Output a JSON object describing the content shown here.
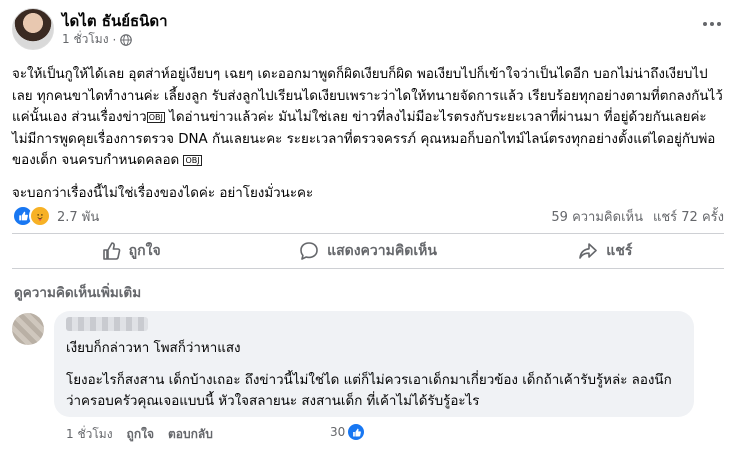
{
  "post": {
    "author": "ไดไต ธันย์ธนิดา",
    "time": "1 ชั่วโมง",
    "paragraph1": "จะให้เป็นกูให้ได้เลย อุตส่าห์อยู่เงียบๆ เฉยๆ เดะออกมาพูดก็ผิดเงียบก็ผิด พอเงียบไปก็เข้าใจว่าเป็นไดอีก บอกไม่น่าถึงเงียบไปเลย ทุกคนขาไดทำงานค่ะ เลี้ยงลูก รับส่งลูกไปเรียนไดเงียบเพราะว่าไดให้ทนายจัดการแล้ว เรียบร้อยทุกอย่างตามที่ตกลงกันไว้ แค่นั้นเอง ส่วนเรื่องข่าว",
    "paragraph1b": " ไดอ่านข่าวแล้วค่ะ มันไม่ใช่เลย ข่าวที่ลงไม่มีอะไรตรงกับระยะเวลาที่ผ่านมา ที่อยู่ด้วยกันเลยค่ะ ไม่มีการพูดคุยเรื่องการตรวจ DNA กันเลยนะคะ ระยะเวลาที่ตรวจครรภ์ คุณหมอก็บอกไทม์ไลน์ตรงทุกอย่างตั้งแต่ไดอยู่กับพ่อของเด็ก จนครบกำหนดคลอด ",
    "obj_glyph": "OBJ",
    "paragraph2": "จะบอกว่าเรื่องนี้ไม่ใช่เรื่องของไดค่ะ อย่าโยงมั่วนะคะ",
    "reaction_count": "2.7 พัน",
    "comments_count": "59 ความคิดเห็น",
    "shares_count": "แชร์ 72 ครั้ง"
  },
  "actions": {
    "like": "ถูกใจ",
    "comment": "แสดงความคิดเห็น",
    "share": "แชร์"
  },
  "more_comments": "ดูความคิดเห็นเพิ่มเติม",
  "comment": {
    "line1": "เงียบก็กล่าวหา โพสก็ว่าหาแสง",
    "line2": "โยงอะไรก็สงสาน เด็กบ้างเถอะ ถึงข่าวนี้ไม่ใช่ได แต่ก็ไม่ควรเอาเด็กมาเกี่ยวข้อง เด็กถ้าเค้ารับรู้หล่ะ ลองนึกว่าครอบครัวคุณเจอแบบนี้ หัวใจสลายนะ สงสานเด็ก ที่เค้าไม่ได้รับรู้อะไร",
    "time": "1 ชั่วโมง",
    "like_label": "ถูกใจ",
    "reply_label": "ตอบกลับ",
    "reaction_count": "30"
  },
  "colors": {
    "facebook_blue": "#1877f2",
    "secondary_text": "#65676b",
    "bubble_bg": "#f0f2f5"
  }
}
